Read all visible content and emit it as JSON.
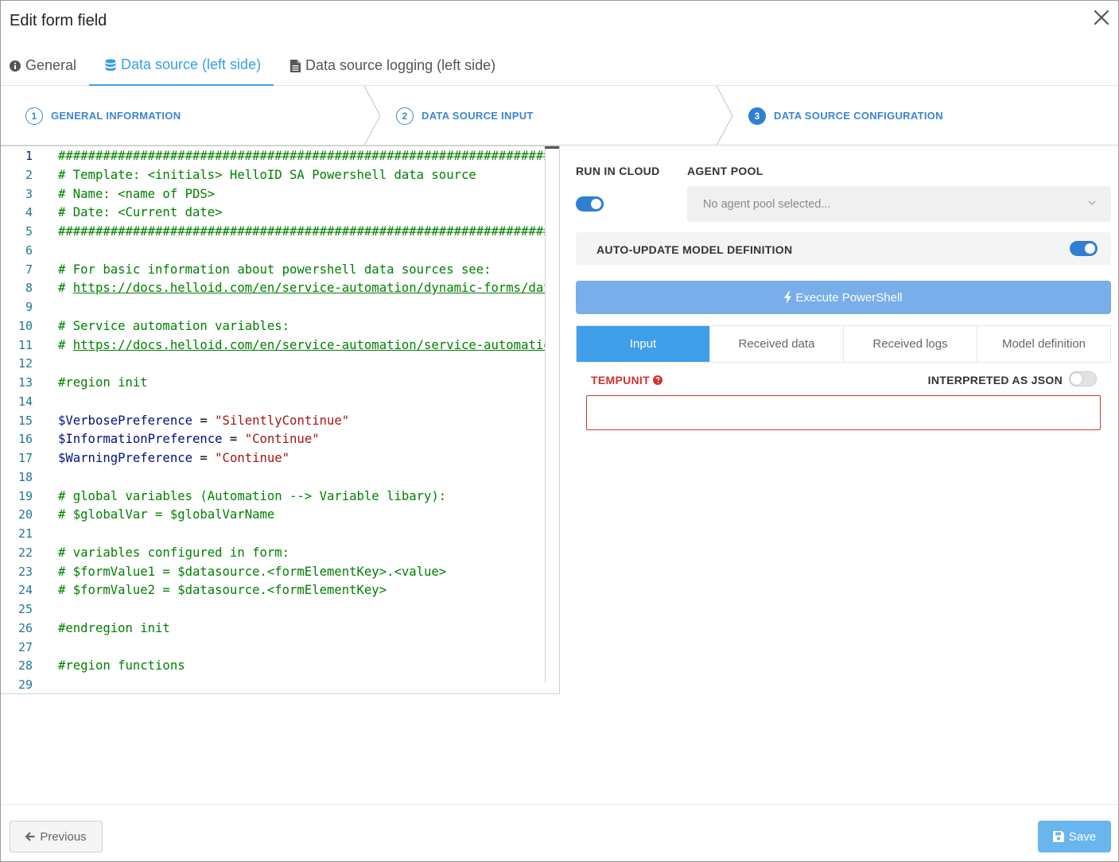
{
  "dialog": {
    "title": "Edit form field"
  },
  "tabs": [
    {
      "label": "General",
      "icon": "info-circle-icon"
    },
    {
      "label": "Data source (left side)",
      "icon": "database-icon",
      "active": true
    },
    {
      "label": "Data source logging (left side)",
      "icon": "file-text-icon"
    }
  ],
  "steps": [
    {
      "number": "1",
      "label": "GENERAL INFORMATION"
    },
    {
      "number": "2",
      "label": "DATA SOURCE INPUT"
    },
    {
      "number": "3",
      "label": "DATA SOURCE CONFIGURATION",
      "current": true
    }
  ],
  "editor": {
    "line_numbers": [
      "1",
      "2",
      "3",
      "4",
      "5",
      "6",
      "7",
      "8",
      "9",
      "10",
      "11",
      "12",
      "13",
      "14",
      "15",
      "16",
      "17",
      "18",
      "19",
      "20",
      "21",
      "22",
      "23",
      "24",
      "25",
      "26",
      "27",
      "28",
      "29"
    ],
    "lines": [
      [
        {
          "t": "#####################################################################################",
          "c": "cmt"
        }
      ],
      [
        {
          "t": "# Template: <initials> HelloID SA Powershell data source",
          "c": "cmt"
        }
      ],
      [
        {
          "t": "# Name: <name of PDS>",
          "c": "cmt"
        }
      ],
      [
        {
          "t": "# Date: <Current date>",
          "c": "cmt"
        }
      ],
      [
        {
          "t": "#####################################################################################",
          "c": "cmt"
        }
      ],
      [],
      [
        {
          "t": "# For basic information about powershell data sources see:",
          "c": "cmt"
        }
      ],
      [
        {
          "t": "# ",
          "c": "cmt"
        },
        {
          "t": "https://docs.helloid.com/en/service-automation/dynamic-forms/data-sources/powershell-data-sources",
          "c": "link"
        }
      ],
      [],
      [
        {
          "t": "# Service automation variables:",
          "c": "cmt"
        }
      ],
      [
        {
          "t": "# ",
          "c": "cmt"
        },
        {
          "t": "https://docs.helloid.com/en/service-automation/service-automation-variables",
          "c": "link"
        }
      ],
      [],
      [
        {
          "t": "#region init",
          "c": "cmt"
        }
      ],
      [],
      [
        {
          "t": "$VerbosePreference",
          "c": "var"
        },
        {
          "t": " = ",
          "c": "def"
        },
        {
          "t": "\"SilentlyContinue\"",
          "c": "str"
        }
      ],
      [
        {
          "t": "$InformationPreference",
          "c": "var"
        },
        {
          "t": " = ",
          "c": "def"
        },
        {
          "t": "\"Continue\"",
          "c": "str"
        }
      ],
      [
        {
          "t": "$WarningPreference",
          "c": "var"
        },
        {
          "t": " = ",
          "c": "def"
        },
        {
          "t": "\"Continue\"",
          "c": "str"
        }
      ],
      [],
      [
        {
          "t": "# global variables (Automation --> Variable libary):",
          "c": "cmt"
        }
      ],
      [
        {
          "t": "# $globalVar = $globalVarName",
          "c": "cmt"
        }
      ],
      [],
      [
        {
          "t": "# variables configured in form:",
          "c": "cmt"
        }
      ],
      [
        {
          "t": "# $formValue1 = $datasource.<formElementKey>.<value>",
          "c": "cmt"
        }
      ],
      [
        {
          "t": "# $formValue2 = $datasource.<formElementKey>",
          "c": "cmt"
        }
      ],
      [],
      [
        {
          "t": "#endregion init",
          "c": "cmt"
        }
      ],
      [],
      [
        {
          "t": "#region functions",
          "c": "cmt"
        }
      ],
      []
    ]
  },
  "config": {
    "run_in_cloud_label": "RUN IN CLOUD",
    "run_in_cloud_on": true,
    "agent_pool_label": "AGENT POOL",
    "agent_pool_placeholder": "No agent pool selected...",
    "auto_update_label": "AUTO-UPDATE MODEL DEFINITION",
    "auto_update_on": true,
    "execute_label": "Execute PowerShell",
    "subtabs": [
      "Input",
      "Received data",
      "Received logs",
      "Model definition"
    ],
    "active_subtab": "Input",
    "field_label": "TEMPUNIT",
    "json_label": "INTERPRETED AS JSON",
    "json_on": false,
    "field_value": ""
  },
  "footer": {
    "previous_label": "Previous",
    "save_label": "Save"
  },
  "colors": {
    "accent": "#3a9ee4",
    "error": "#d0342c",
    "execute_button": "#78aee9",
    "save_button": "#69b5ee"
  }
}
